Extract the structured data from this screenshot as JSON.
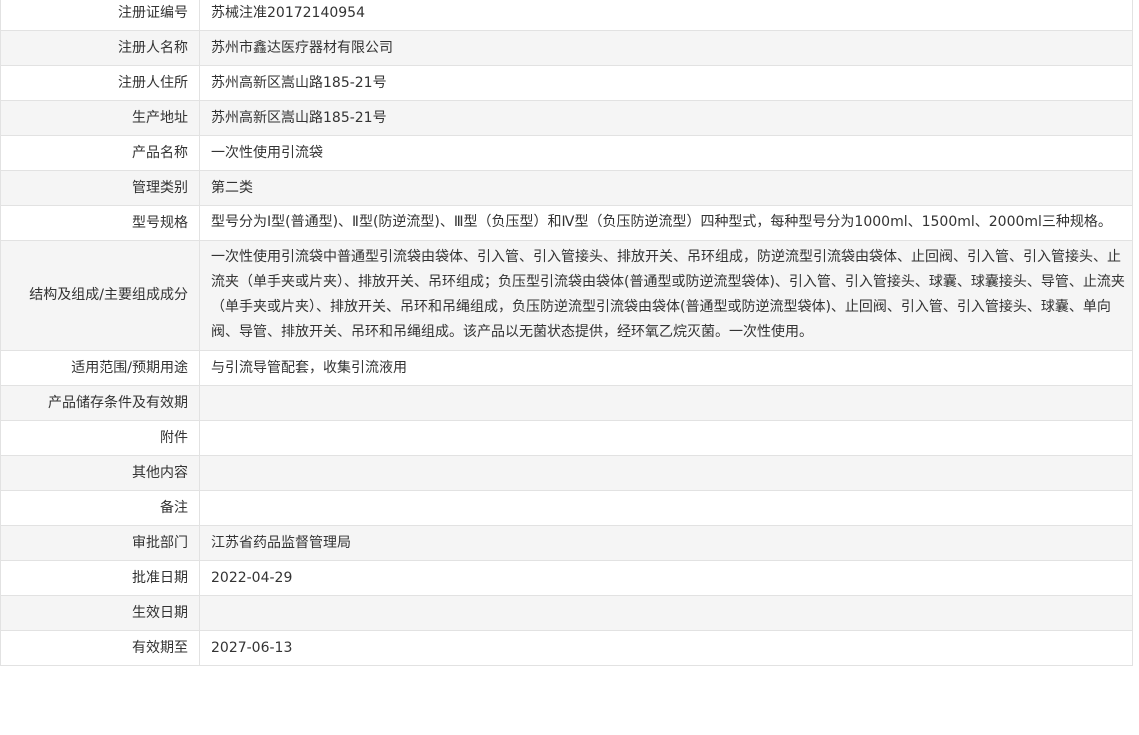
{
  "rows": [
    {
      "label": "注册证编号",
      "value": "苏械注准20172140954"
    },
    {
      "label": "注册人名称",
      "value": "苏州市鑫达医疗器材有限公司"
    },
    {
      "label": "注册人住所",
      "value": "苏州高新区嵩山路185-21号"
    },
    {
      "label": "生产地址",
      "value": "苏州高新区嵩山路185-21号"
    },
    {
      "label": "产品名称",
      "value": "一次性使用引流袋"
    },
    {
      "label": "管理类别",
      "value": "第二类"
    },
    {
      "label": "型号规格",
      "value": "型号分为Ⅰ型(普通型)、Ⅱ型(防逆流型)、Ⅲ型（负压型）和Ⅳ型（负压防逆流型）四种型式，每种型号分为1000ml、1500ml、2000ml三种规格。"
    },
    {
      "label": "结构及组成/主要组成成分",
      "value": "一次性使用引流袋中普通型引流袋由袋体、引入管、引入管接头、排放开关、吊环组成，防逆流型引流袋由袋体、止回阀、引入管、引入管接头、止流夹（单手夹或片夹）、排放开关、吊环组成；负压型引流袋由袋体(普通型或防逆流型袋体)、引入管、引入管接头、球囊、球囊接头、导管、止流夹（单手夹或片夹）、排放开关、吊环和吊绳组成，负压防逆流型引流袋由袋体(普通型或防逆流型袋体)、止回阀、引入管、引入管接头、球囊、单向阀、导管、排放开关、吊环和吊绳组成。该产品以无菌状态提供，经环氧乙烷灭菌。一次性使用。"
    },
    {
      "label": "适用范围/预期用途",
      "value": "与引流导管配套，收集引流液用"
    },
    {
      "label": "产品储存条件及有效期",
      "value": ""
    },
    {
      "label": "附件",
      "value": ""
    },
    {
      "label": "其他内容",
      "value": ""
    },
    {
      "label": "备注",
      "value": ""
    },
    {
      "label": "审批部门",
      "value": "江苏省药品监督管理局"
    },
    {
      "label": "批准日期",
      "value": "2022-04-29"
    },
    {
      "label": "生效日期",
      "value": ""
    },
    {
      "label": "有效期至",
      "value": "2027-06-13"
    }
  ]
}
